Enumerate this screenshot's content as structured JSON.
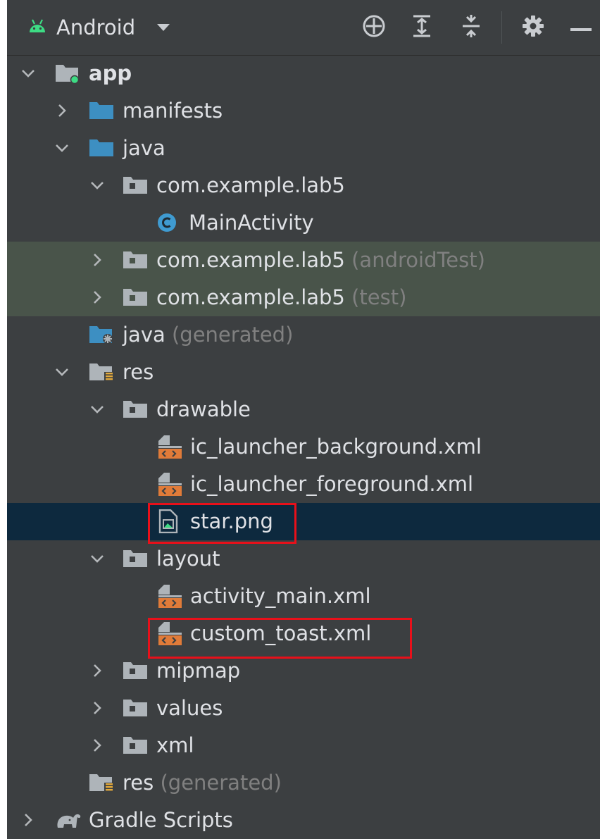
{
  "toolbar": {
    "view_label": "Android",
    "icons": [
      "android-icon",
      "chevron-down-icon",
      "locate-crosshair-icon",
      "expand-all-icon",
      "collapse-all-icon",
      "gear-icon",
      "minimize-icon"
    ]
  },
  "tree": {
    "app": "app",
    "manifests": "manifests",
    "java": "java",
    "pkg_main": "com.example.lab5",
    "main_activity": "MainActivity",
    "pkg_android_test": "com.example.lab5",
    "pkg_android_test_suffix": "(androidTest)",
    "pkg_test": "com.example.lab5",
    "pkg_test_suffix": "(test)",
    "java_generated": "java",
    "java_generated_suffix": "(generated)",
    "res": "res",
    "drawable": "drawable",
    "ic_launcher_background": "ic_launcher_background.xml",
    "ic_launcher_foreground": "ic_launcher_foreground.xml",
    "star_png": "star.png",
    "layout": "layout",
    "activity_main": "activity_main.xml",
    "custom_toast": "custom_toast.xml",
    "mipmap": "mipmap",
    "values": "values",
    "xml": "xml",
    "res_generated": "res",
    "res_generated_suffix": "(generated)",
    "gradle_scripts": "Gradle Scripts"
  },
  "colors": {
    "panel_bg": "#3c3f41",
    "text": "#dfe1e5",
    "muted_suffix": "#808080",
    "test_row_bg": "#49544a",
    "selected_row_bg": "#0d293e",
    "highlight_box": "#e8101a",
    "folder_blue": "#3d8fc2",
    "folder_grey": "#aeb4b9",
    "android_green": "#3ddc84",
    "xml_orange": "#e07b39",
    "class_blue": "#3f9bd1"
  }
}
